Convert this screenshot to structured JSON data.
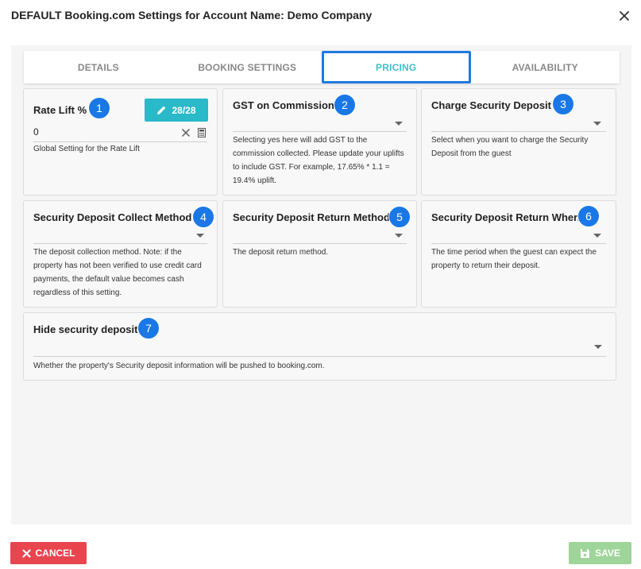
{
  "dialog": {
    "title": "DEFAULT Booking.com Settings for Account Name: Demo Company"
  },
  "tabs": [
    {
      "label": "DETAILS",
      "active": false
    },
    {
      "label": "BOOKING SETTINGS",
      "active": false
    },
    {
      "label": "PRICING",
      "active": true
    },
    {
      "label": "AVAILABILITY",
      "active": false
    }
  ],
  "cards": {
    "rate_lift": {
      "title": "Rate Lift %",
      "badge": "1",
      "count_label": "28/28",
      "value": "0",
      "help": "Global Setting for the Rate Lift"
    },
    "gst": {
      "title": "GST on Commission",
      "badge": "2",
      "help": "Selecting yes here will add GST to the commission collected. Please update your uplifts to include GST. For example, 17.65% * 1.1 = 19.4% uplift."
    },
    "charge_deposit": {
      "title": "Charge Security Deposit",
      "badge": "3",
      "help": "Select when you want to charge the Security Deposit from the guest"
    },
    "collect_method": {
      "title": "Security Deposit Collect Method",
      "badge": "4",
      "help": "The deposit collection method. Note: if the property has not been verified to use credit card payments, the default value becomes cash regardless of this setting."
    },
    "return_method": {
      "title": "Security Deposit Return Method",
      "badge": "5",
      "help": "The deposit return method."
    },
    "return_when": {
      "title": "Security Deposit Return When",
      "badge": "6",
      "help": "The time period when the guest can expect the property to return their deposit."
    },
    "hide_deposit": {
      "title": "Hide security deposit",
      "badge": "7",
      "help": "Whether the property's Security deposit information will be pushed to booking.com."
    }
  },
  "footer": {
    "cancel_label": "CANCEL",
    "save_label": "SAVE"
  },
  "colors": {
    "accent_teal": "#29b9c8",
    "badge_blue": "#1a78e6",
    "cancel_red": "#e8454f",
    "save_green": "#9fd49a"
  },
  "icons": [
    "close-icon",
    "pencil-icon",
    "clear-icon",
    "calculator-icon",
    "chevron-down-icon",
    "cancel-x-icon",
    "save-disk-icon"
  ]
}
